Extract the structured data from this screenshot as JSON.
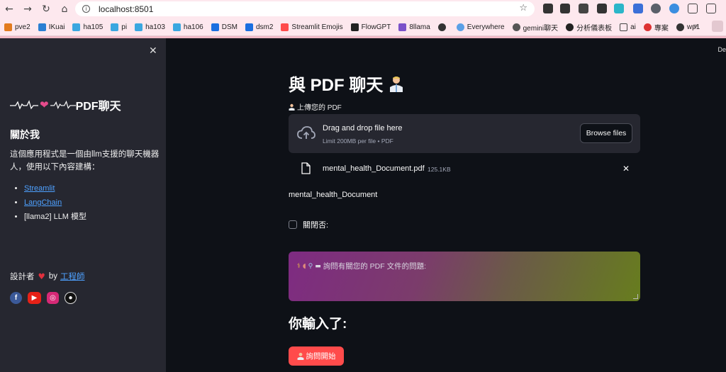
{
  "browser": {
    "url": "localhost:8501",
    "bookmarks": [
      "pve2",
      "IKuai",
      "ha105",
      "pi",
      "ha103",
      "ha106",
      "DSM",
      "dsm2",
      "Streamlit Emojis",
      "FlowGPT",
      "8llama",
      "",
      "Everywhere",
      "gemini聊天",
      "分析儀表板",
      "ai",
      "專案",
      "wp1"
    ],
    "bookmark_more": "»"
  },
  "sidebar": {
    "title": "PDF聊天",
    "about_heading": "關於我",
    "description": "這個應用程式是一個由llm支援的聊天機器人，使用以下內容建構：",
    "links": [
      "Streamlit",
      "LangChain"
    ],
    "list_plain": "[llama2] LLM 模型",
    "credit_prefix": "設計者",
    "credit_by": "by",
    "credit_link": "工程師"
  },
  "main": {
    "deploy_label": "De",
    "title": "與 PDF 聊天",
    "upload_label": "上傳您的 PDF",
    "dropzone": {
      "title": "Drag and drop file here",
      "subtitle": "Limit 200MB per file • PDF",
      "browse": "Browse files"
    },
    "file": {
      "name": "mental_health_Document.pdf",
      "size": "125.1KB"
    },
    "doc_name": "mental_health_Document",
    "checkbox_label": "關閉否:",
    "question_placeholder": "詢問有關您的 PDF 文件的問題:",
    "you_entered": "你輸入了:",
    "ask_button": "詢問開始"
  },
  "colors": {
    "primary": "#ff4b4b",
    "sidebar_bg": "#262730",
    "app_bg": "#0e1117",
    "link": "#4ea1ff"
  }
}
